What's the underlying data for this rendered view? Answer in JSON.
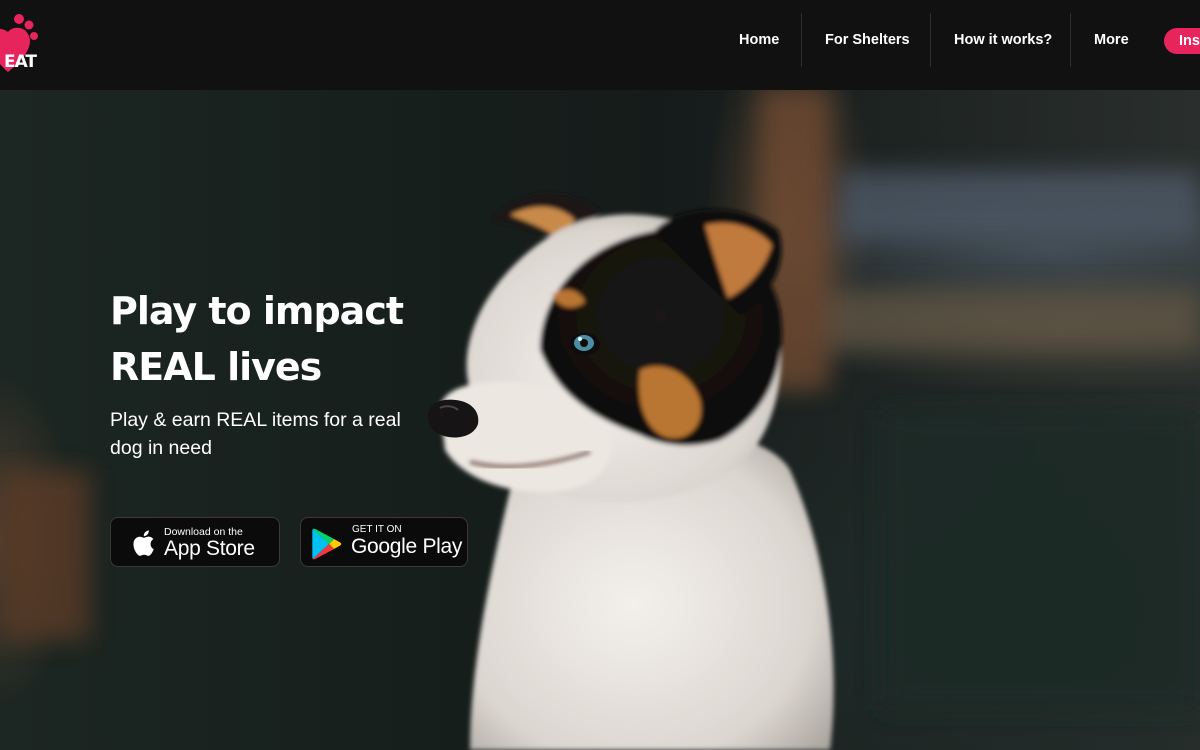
{
  "brand": {
    "logo_text": "EAT",
    "accent_color": "#e8245c"
  },
  "nav": {
    "items": [
      {
        "label": "Home"
      },
      {
        "label": "For Shelters"
      },
      {
        "label": "How it works?"
      },
      {
        "label": "More"
      }
    ],
    "install_label": "Inst"
  },
  "hero": {
    "title_line1": "Play to impact",
    "title_line2": "REAL lives",
    "subtitle": "Play & earn REAL items for a real dog in need",
    "app_store": {
      "small": "Download on the",
      "big": "App Store",
      "icon": "apple-icon"
    },
    "google_play": {
      "small": "GET IT ON",
      "big": "Google Play",
      "icon": "google-play-icon"
    },
    "image": "puppy-photo"
  }
}
